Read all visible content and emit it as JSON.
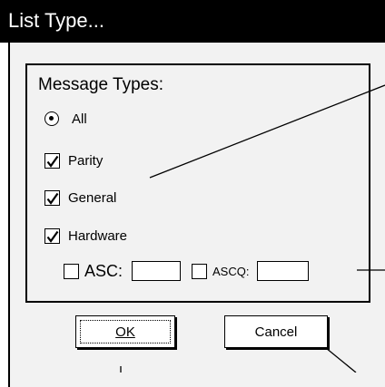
{
  "window": {
    "title": "List Type..."
  },
  "group": {
    "title": "Message Types:"
  },
  "options": {
    "all_label": "All",
    "parity_label": "Parity",
    "general_label": "General",
    "hardware_label": "Hardware"
  },
  "filters": {
    "asc_label": "ASC:",
    "ascq_label": "ASCQ:",
    "asc_value": "",
    "ascq_value": ""
  },
  "buttons": {
    "ok_label": "OK",
    "cancel_label": "Cancel"
  },
  "state": {
    "all_selected": true,
    "parity_checked": true,
    "general_checked": true,
    "hardware_checked": true,
    "asc_checked": false,
    "ascq_checked": false
  }
}
